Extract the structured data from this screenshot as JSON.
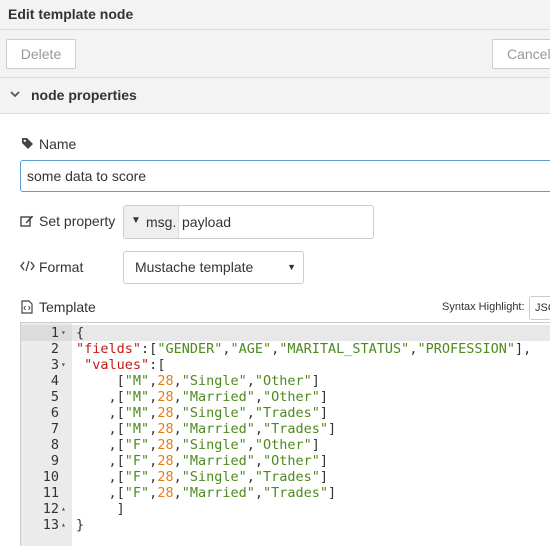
{
  "title": "Edit template node",
  "toolbar": {
    "delete_label": "Delete",
    "cancel_label": "Cancel"
  },
  "section": {
    "label": "node properties",
    "chevron_icon": "chevron-down-icon"
  },
  "name_field": {
    "label": "Name",
    "value": "some data to score"
  },
  "set_property": {
    "label": "Set property",
    "type": "msg.",
    "value": "payload"
  },
  "format": {
    "label": "Format",
    "selected": "Mustache template"
  },
  "template": {
    "label": "Template",
    "syntax_label": "Syntax Highlight:",
    "syntax_value": "JSON"
  },
  "code_lines": [
    {
      "n": "1",
      "fold": "▾",
      "text": "{"
    },
    {
      "n": "2",
      "fold": "",
      "text": "\"fields\":[\"GENDER\",\"AGE\",\"MARITAL_STATUS\",\"PROFESSION\"],"
    },
    {
      "n": "3",
      "fold": "▾",
      "text": " \"values\":["
    },
    {
      "n": "4",
      "fold": "",
      "text": "     [\"M\",28,\"Single\",\"Other\"]"
    },
    {
      "n": "5",
      "fold": "",
      "text": "    ,[\"M\",28,\"Married\",\"Other\"]"
    },
    {
      "n": "6",
      "fold": "",
      "text": "    ,[\"M\",28,\"Single\",\"Trades\"]"
    },
    {
      "n": "7",
      "fold": "",
      "text": "    ,[\"M\",28,\"Married\",\"Trades\"]"
    },
    {
      "n": "8",
      "fold": "",
      "text": "    ,[\"F\",28,\"Single\",\"Other\"]"
    },
    {
      "n": "9",
      "fold": "",
      "text": "    ,[\"F\",28,\"Married\",\"Other\"]"
    },
    {
      "n": "10",
      "fold": "",
      "text": "    ,[\"F\",28,\"Single\",\"Trades\"]"
    },
    {
      "n": "11",
      "fold": "",
      "text": "    ,[\"F\",28,\"Married\",\"Trades\"]"
    },
    {
      "n": "12",
      "fold": "▴",
      "text": "     ]"
    },
    {
      "n": "13",
      "fold": "▴",
      "text": "}"
    }
  ],
  "active_line": 1,
  "colors": {
    "key": "#c41a16",
    "string": "#4e8a1b",
    "number": "#e87b13",
    "focus_border": "#5b9bd5"
  }
}
